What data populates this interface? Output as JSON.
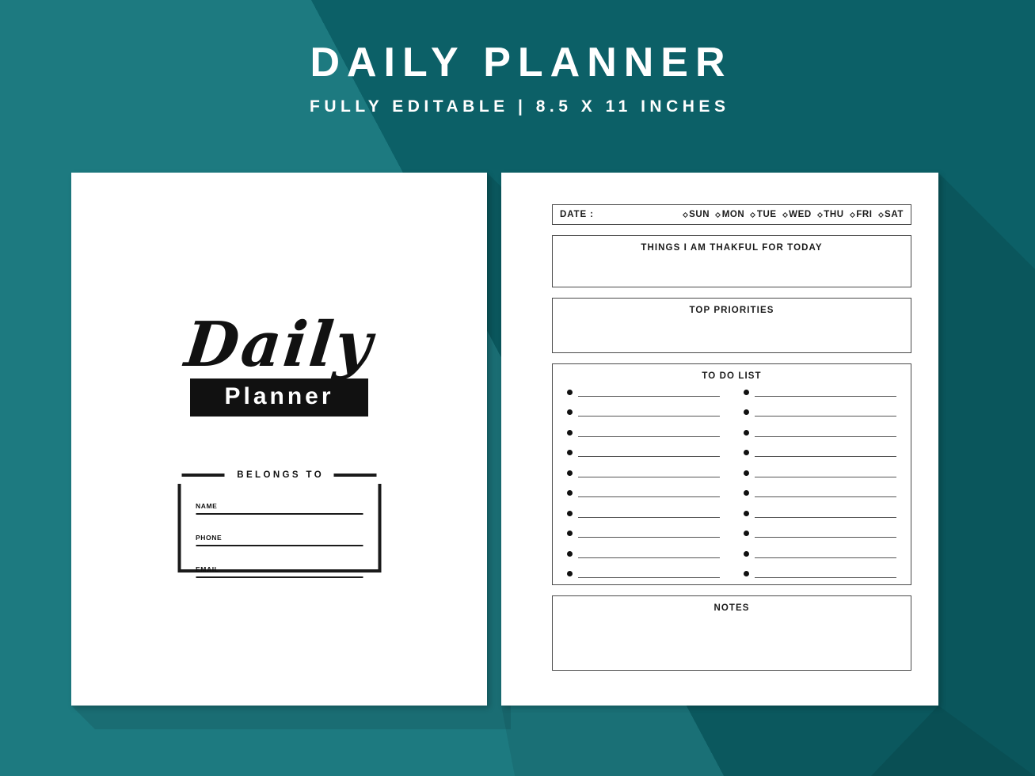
{
  "header": {
    "title": "DAILY PLANNER",
    "subtitle": "FULLY EDITABLE | 8.5 X 11 INCHES"
  },
  "colors": {
    "background_light": "#1d7a80",
    "background_dark": "#0c6067",
    "page": "#ffffff",
    "ink": "#111111",
    "rule": "#4a4a4a"
  },
  "cover_page": {
    "logo_script": "Daily",
    "logo_bar": "Planner",
    "belongs_to": {
      "label": "BELONGS TO",
      "fields": [
        {
          "label": "NAME",
          "value": ""
        },
        {
          "label": "PHONE",
          "value": ""
        },
        {
          "label": "EMAIL",
          "value": ""
        }
      ]
    }
  },
  "interior_page": {
    "date_row": {
      "label": "DATE :",
      "value": "",
      "days": [
        "SUN",
        "MON",
        "TUE",
        "WED",
        "THU",
        "FRI",
        "SAT"
      ]
    },
    "sections": [
      {
        "title": "THINGS I AM THAKFUL FOR TODAY",
        "value": ""
      },
      {
        "title": "TOP PRIORITIES",
        "value": ""
      },
      {
        "title": "TO DO LIST",
        "value": ""
      },
      {
        "title": "NOTES",
        "value": ""
      }
    ],
    "todo": {
      "title": "TO DO LIST",
      "rows_per_column": 10,
      "columns": 2,
      "left_column": [
        "",
        "",
        "",
        "",
        "",
        "",
        "",
        "",
        "",
        ""
      ],
      "right_column": [
        "",
        "",
        "",
        "",
        "",
        "",
        "",
        "",
        "",
        ""
      ]
    },
    "thankful_title": "THINGS I AM THAKFUL FOR TODAY",
    "priorities_title": "TOP PRIORITIES",
    "notes_title": "NOTES"
  }
}
